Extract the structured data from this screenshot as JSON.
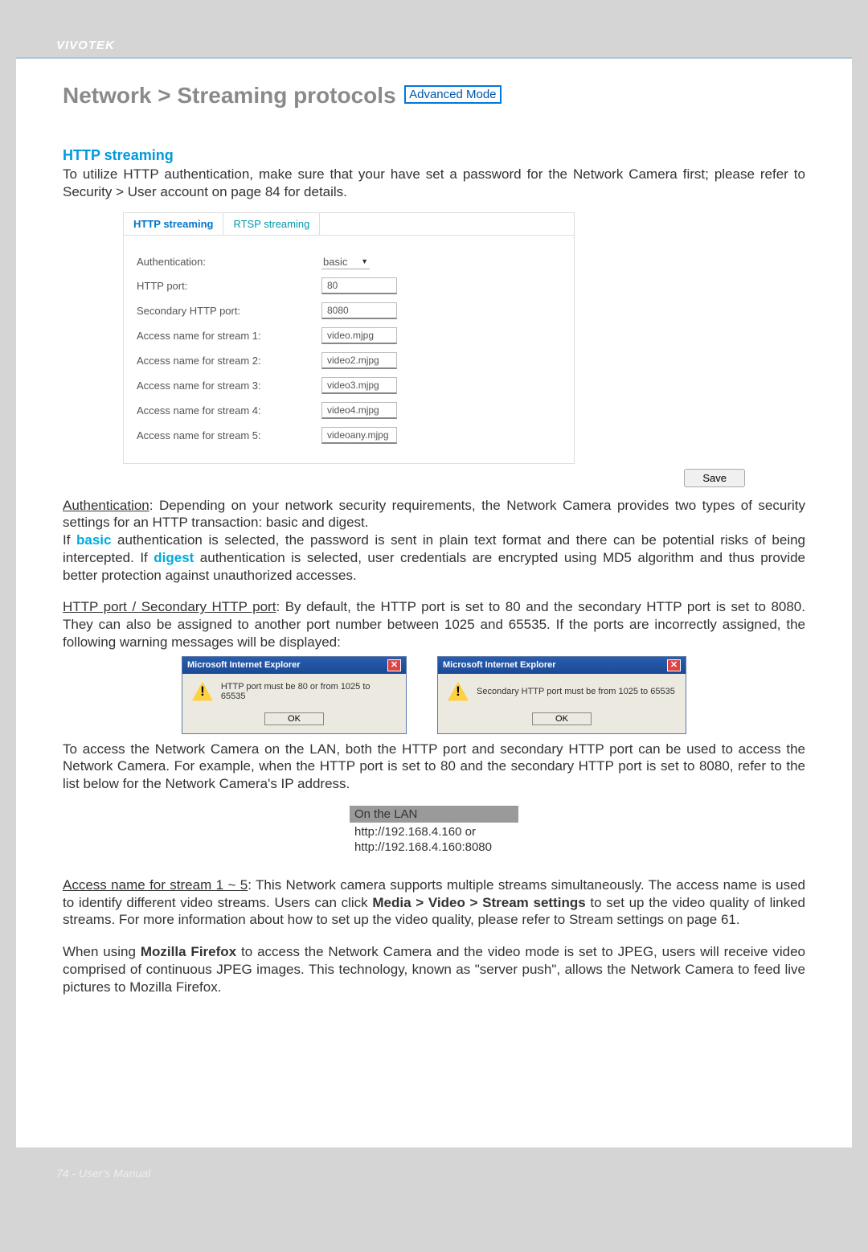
{
  "brand": "VIVOTEK",
  "heading": "Network > Streaming protocols",
  "badge": "Advanced Mode",
  "section": "HTTP streaming",
  "intro": "To utilize HTTP authentication, make sure that your have set a password for the Network Camera first; please refer to Security > User account on page 84 for details.",
  "panel": {
    "tabs": {
      "active": "HTTP streaming",
      "inactive": "RTSP streaming"
    },
    "rows": [
      {
        "label": "Authentication:",
        "value": "basic",
        "type": "select"
      },
      {
        "label": "HTTP port:",
        "value": "80",
        "type": "text"
      },
      {
        "label": "Secondary HTTP port:",
        "value": "8080",
        "type": "text"
      },
      {
        "label": "Access name for stream 1:",
        "value": "video.mjpg",
        "type": "text"
      },
      {
        "label": "Access name for stream 2:",
        "value": "video2.mjpg",
        "type": "text"
      },
      {
        "label": "Access name for stream 3:",
        "value": "video3.mjpg",
        "type": "text"
      },
      {
        "label": "Access name for stream 4:",
        "value": "video4.mjpg",
        "type": "text"
      },
      {
        "label": "Access name for stream 5:",
        "value": "videoany.mjpg",
        "type": "text"
      }
    ],
    "save": "Save"
  },
  "para_auth_1": "Authentication",
  "para_auth_2": ": Depending on your network security requirements, the Network Camera provides two types of security settings for an HTTP transaction: basic and digest.",
  "para_auth_3a": "If ",
  "para_auth_3b": "basic",
  "para_auth_3c": " authentication is selected, the password is sent in plain text format and there can be potential risks of being intercepted. If ",
  "para_auth_3d": "digest",
  "para_auth_3e": " authentication is selected, user credentials are encrypted using MD5 algorithm and thus provide better protection against unauthorized accesses.",
  "para_port_1": "HTTP port / Secondary HTTP port",
  "para_port_2": ": By default, the HTTP port is set to 80 and the secondary HTTP port is set to 8080. They can also be assigned to another port number between 1025 and 65535. If the ports are incorrectly assigned, the following warning messages will be displayed:",
  "dialog_title": "Microsoft Internet Explorer",
  "dialog1_msg": "HTTP port must be 80 or from 1025 to 65535",
  "dialog2_msg": "Secondary HTTP port must be from 1025 to 65535",
  "dialog_ok": "OK",
  "para_lan": "To access the Network Camera on the LAN, both the HTTP port and secondary HTTP port can be used to access the Network Camera. For example, when the HTTP port is set to 80 and the secondary HTTP port is set to 8080, refer to the list below for the Network Camera's IP address.",
  "lan": {
    "header": "On the LAN",
    "line1": "http://192.168.4.160  or",
    "line2": "http://192.168.4.160:8080"
  },
  "para_access_1": "Access name for stream 1 ~ 5",
  "para_access_2": ": This Network camera supports multiple streams simultaneously. The access name is used to identify different video streams. Users can click ",
  "para_access_3": "Media > Video > Stream settings",
  "para_access_4": " to set up the video quality of linked streams. For more information about how to set up the video quality, please refer to Stream settings on page 61.",
  "para_ff_1": "When using ",
  "para_ff_2": "Mozilla Firefox",
  "para_ff_3": " to access the Network Camera and the video mode is set to JPEG, users will receive video comprised of continuous JPEG images. This technology, known as \"server push\", allows the Network Camera to feed live pictures to Mozilla Firefox.",
  "footer": "74 - User's Manual"
}
